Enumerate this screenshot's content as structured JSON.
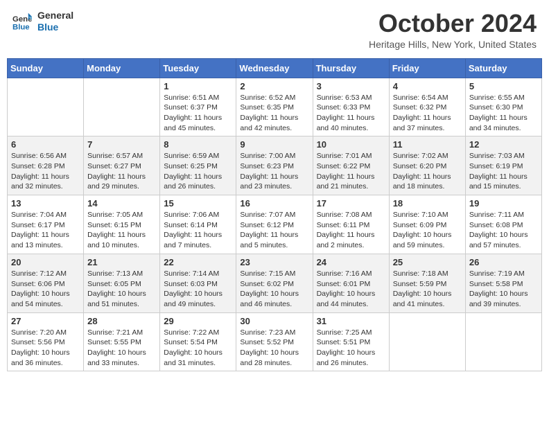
{
  "header": {
    "logo_line1": "General",
    "logo_line2": "Blue",
    "month": "October 2024",
    "location": "Heritage Hills, New York, United States"
  },
  "days_of_week": [
    "Sunday",
    "Monday",
    "Tuesday",
    "Wednesday",
    "Thursday",
    "Friday",
    "Saturday"
  ],
  "weeks": [
    [
      {
        "day": "",
        "sunrise": "",
        "sunset": "",
        "daylight": ""
      },
      {
        "day": "",
        "sunrise": "",
        "sunset": "",
        "daylight": ""
      },
      {
        "day": "1",
        "sunrise": "Sunrise: 6:51 AM",
        "sunset": "Sunset: 6:37 PM",
        "daylight": "Daylight: 11 hours and 45 minutes."
      },
      {
        "day": "2",
        "sunrise": "Sunrise: 6:52 AM",
        "sunset": "Sunset: 6:35 PM",
        "daylight": "Daylight: 11 hours and 42 minutes."
      },
      {
        "day": "3",
        "sunrise": "Sunrise: 6:53 AM",
        "sunset": "Sunset: 6:33 PM",
        "daylight": "Daylight: 11 hours and 40 minutes."
      },
      {
        "day": "4",
        "sunrise": "Sunrise: 6:54 AM",
        "sunset": "Sunset: 6:32 PM",
        "daylight": "Daylight: 11 hours and 37 minutes."
      },
      {
        "day": "5",
        "sunrise": "Sunrise: 6:55 AM",
        "sunset": "Sunset: 6:30 PM",
        "daylight": "Daylight: 11 hours and 34 minutes."
      }
    ],
    [
      {
        "day": "6",
        "sunrise": "Sunrise: 6:56 AM",
        "sunset": "Sunset: 6:28 PM",
        "daylight": "Daylight: 11 hours and 32 minutes."
      },
      {
        "day": "7",
        "sunrise": "Sunrise: 6:57 AM",
        "sunset": "Sunset: 6:27 PM",
        "daylight": "Daylight: 11 hours and 29 minutes."
      },
      {
        "day": "8",
        "sunrise": "Sunrise: 6:59 AM",
        "sunset": "Sunset: 6:25 PM",
        "daylight": "Daylight: 11 hours and 26 minutes."
      },
      {
        "day": "9",
        "sunrise": "Sunrise: 7:00 AM",
        "sunset": "Sunset: 6:23 PM",
        "daylight": "Daylight: 11 hours and 23 minutes."
      },
      {
        "day": "10",
        "sunrise": "Sunrise: 7:01 AM",
        "sunset": "Sunset: 6:22 PM",
        "daylight": "Daylight: 11 hours and 21 minutes."
      },
      {
        "day": "11",
        "sunrise": "Sunrise: 7:02 AM",
        "sunset": "Sunset: 6:20 PM",
        "daylight": "Daylight: 11 hours and 18 minutes."
      },
      {
        "day": "12",
        "sunrise": "Sunrise: 7:03 AM",
        "sunset": "Sunset: 6:19 PM",
        "daylight": "Daylight: 11 hours and 15 minutes."
      }
    ],
    [
      {
        "day": "13",
        "sunrise": "Sunrise: 7:04 AM",
        "sunset": "Sunset: 6:17 PM",
        "daylight": "Daylight: 11 hours and 13 minutes."
      },
      {
        "day": "14",
        "sunrise": "Sunrise: 7:05 AM",
        "sunset": "Sunset: 6:15 PM",
        "daylight": "Daylight: 11 hours and 10 minutes."
      },
      {
        "day": "15",
        "sunrise": "Sunrise: 7:06 AM",
        "sunset": "Sunset: 6:14 PM",
        "daylight": "Daylight: 11 hours and 7 minutes."
      },
      {
        "day": "16",
        "sunrise": "Sunrise: 7:07 AM",
        "sunset": "Sunset: 6:12 PM",
        "daylight": "Daylight: 11 hours and 5 minutes."
      },
      {
        "day": "17",
        "sunrise": "Sunrise: 7:08 AM",
        "sunset": "Sunset: 6:11 PM",
        "daylight": "Daylight: 11 hours and 2 minutes."
      },
      {
        "day": "18",
        "sunrise": "Sunrise: 7:10 AM",
        "sunset": "Sunset: 6:09 PM",
        "daylight": "Daylight: 10 hours and 59 minutes."
      },
      {
        "day": "19",
        "sunrise": "Sunrise: 7:11 AM",
        "sunset": "Sunset: 6:08 PM",
        "daylight": "Daylight: 10 hours and 57 minutes."
      }
    ],
    [
      {
        "day": "20",
        "sunrise": "Sunrise: 7:12 AM",
        "sunset": "Sunset: 6:06 PM",
        "daylight": "Daylight: 10 hours and 54 minutes."
      },
      {
        "day": "21",
        "sunrise": "Sunrise: 7:13 AM",
        "sunset": "Sunset: 6:05 PM",
        "daylight": "Daylight: 10 hours and 51 minutes."
      },
      {
        "day": "22",
        "sunrise": "Sunrise: 7:14 AM",
        "sunset": "Sunset: 6:03 PM",
        "daylight": "Daylight: 10 hours and 49 minutes."
      },
      {
        "day": "23",
        "sunrise": "Sunrise: 7:15 AM",
        "sunset": "Sunset: 6:02 PM",
        "daylight": "Daylight: 10 hours and 46 minutes."
      },
      {
        "day": "24",
        "sunrise": "Sunrise: 7:16 AM",
        "sunset": "Sunset: 6:01 PM",
        "daylight": "Daylight: 10 hours and 44 minutes."
      },
      {
        "day": "25",
        "sunrise": "Sunrise: 7:18 AM",
        "sunset": "Sunset: 5:59 PM",
        "daylight": "Daylight: 10 hours and 41 minutes."
      },
      {
        "day": "26",
        "sunrise": "Sunrise: 7:19 AM",
        "sunset": "Sunset: 5:58 PM",
        "daylight": "Daylight: 10 hours and 39 minutes."
      }
    ],
    [
      {
        "day": "27",
        "sunrise": "Sunrise: 7:20 AM",
        "sunset": "Sunset: 5:56 PM",
        "daylight": "Daylight: 10 hours and 36 minutes."
      },
      {
        "day": "28",
        "sunrise": "Sunrise: 7:21 AM",
        "sunset": "Sunset: 5:55 PM",
        "daylight": "Daylight: 10 hours and 33 minutes."
      },
      {
        "day": "29",
        "sunrise": "Sunrise: 7:22 AM",
        "sunset": "Sunset: 5:54 PM",
        "daylight": "Daylight: 10 hours and 31 minutes."
      },
      {
        "day": "30",
        "sunrise": "Sunrise: 7:23 AM",
        "sunset": "Sunset: 5:52 PM",
        "daylight": "Daylight: 10 hours and 28 minutes."
      },
      {
        "day": "31",
        "sunrise": "Sunrise: 7:25 AM",
        "sunset": "Sunset: 5:51 PM",
        "daylight": "Daylight: 10 hours and 26 minutes."
      },
      {
        "day": "",
        "sunrise": "",
        "sunset": "",
        "daylight": ""
      },
      {
        "day": "",
        "sunrise": "",
        "sunset": "",
        "daylight": ""
      }
    ]
  ]
}
